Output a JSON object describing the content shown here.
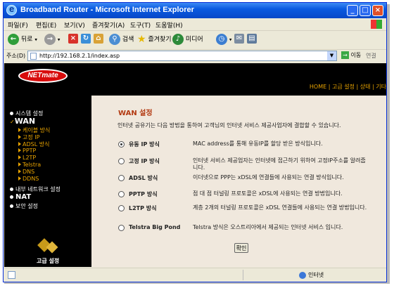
{
  "window": {
    "title": "Broadband Router - Microsoft Internet Explorer",
    "controls": [
      "_",
      "□",
      "×"
    ]
  },
  "menubar": [
    "파일(F)",
    "편집(E)",
    "보기(V)",
    "즐겨찾기(A)",
    "도구(T)",
    "도움말(H)"
  ],
  "toolbar": {
    "back_label": "뒤로",
    "search_label": "검색",
    "favorites_label": "즐겨찾기",
    "media_label": "미디어"
  },
  "address": {
    "label": "주소(D)",
    "url": "http://192.168.2.1/index.asp",
    "go_label": "이동",
    "links_label": "연결"
  },
  "header": {
    "logo": "NETmate",
    "nav": [
      "HOME",
      "고급 설정",
      "상태",
      "기타"
    ]
  },
  "sidebar": {
    "items": [
      {
        "label": "시스템 설정"
      },
      {
        "label": "WAN"
      },
      {
        "label": "내부 네트워크 설정"
      },
      {
        "label": "NAT"
      },
      {
        "label": "보안 설정"
      }
    ],
    "wan_sub": [
      "케이블 방식",
      "고정 IP",
      "ADSL 방식",
      "PPTP",
      "L2TP",
      "Telstra",
      "DNS",
      "DDNS"
    ],
    "advanced_label": "고급 설정"
  },
  "main": {
    "heading": "WAN 설정",
    "description": "인터넷 공유기는 다음 방법을 통하여 고객님의 인터넷 서비스 제공사업자에 결합할 수 있습니다.",
    "options": [
      {
        "label": "유동 IP 방식",
        "text": "MAC address를 통해 유동IP를 할당 받은 방식입니다.",
        "selected": true
      },
      {
        "label": "고정 IP 방식",
        "text": "인터넷 서비스 제공업자는 인터넷에 접근하기 위하여 고정IP주소를 알려줍니다.",
        "selected": false
      },
      {
        "label": "ADSL 방식",
        "text": "이더넷으로 PPP는 xDSL에 연결들에 사용되는 연결 방식입니다.",
        "selected": false
      },
      {
        "label": "PPTP 방식",
        "text": "점 대 점 터널링 프로토콜은 xDSL에 사용되는 연결 방법입니다.",
        "selected": false
      },
      {
        "label": "L2TP 방식",
        "text": "계층 2개의 터널링 프로토콜은 xDSL 연결들에 사용되는 연결 방법입니다.",
        "selected": false
      },
      {
        "label": "Telstra Big Pond",
        "text": "Telstra 방식은 오스트리아에서 제공되는 인터넷 서비스 입니다.",
        "selected": false
      }
    ],
    "ok_label": "확인"
  },
  "status": {
    "zone": "인터넷"
  }
}
